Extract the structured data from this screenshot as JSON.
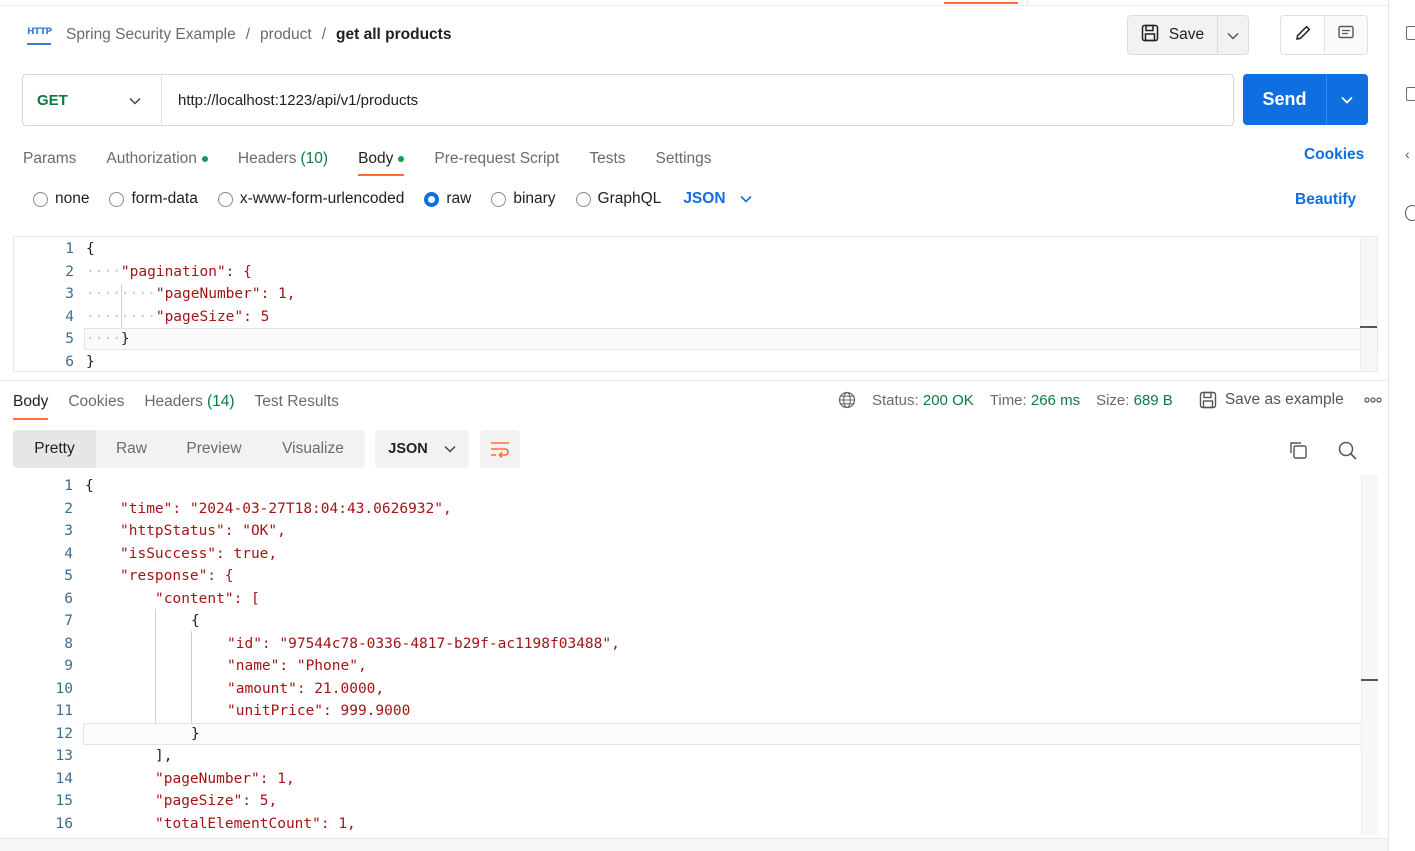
{
  "breadcrumb": {
    "items": [
      "Spring Security Example",
      "product"
    ],
    "separator": "/",
    "current": "get all products"
  },
  "header": {
    "http_icon_label": "HTTP",
    "save_label": "Save"
  },
  "request": {
    "method": "GET",
    "url": "http://localhost:1223/api/v1/products",
    "send_label": "Send",
    "tabs": [
      {
        "label": "Params"
      },
      {
        "label": "Authorization"
      },
      {
        "label": "Headers",
        "count": "(10)"
      },
      {
        "label": "Body"
      },
      {
        "label": "Pre-request Script"
      },
      {
        "label": "Tests"
      },
      {
        "label": "Settings"
      }
    ],
    "cookies_label": "Cookies",
    "body_types": [
      "none",
      "form-data",
      "x-www-form-urlencoded",
      "raw",
      "binary",
      "GraphQL"
    ],
    "selected_body_type": "raw",
    "format": "JSON",
    "beautify_label": "Beautify",
    "body_lines": [
      "{",
      "\"pagination\": {",
      "\"pageNumber\": 1,",
      "\"pageSize\": 5",
      "}",
      "}"
    ]
  },
  "response": {
    "tabs": [
      {
        "label": "Body"
      },
      {
        "label": "Cookies"
      },
      {
        "label": "Headers",
        "count": "(14)"
      },
      {
        "label": "Test Results"
      }
    ],
    "status_label": "Status:",
    "status_value": "200 OK",
    "time_label": "Time:",
    "time_value": "266 ms",
    "size_label": "Size:",
    "size_value": "689 B",
    "save_example_label": "Save as example",
    "view_modes": [
      "Pretty",
      "Raw",
      "Preview",
      "Visualize"
    ],
    "format": "JSON",
    "body_lines": [
      "{",
      "\"time\": \"2024-03-27T18:04:43.0626932\",",
      "\"httpStatus\": \"OK\",",
      "\"isSuccess\": true,",
      "\"response\": {",
      "\"content\": [",
      "{",
      "\"id\": \"97544c78-0336-4817-b29f-ac1198f03488\",",
      "\"name\": \"Phone\",",
      "\"amount\": 21.0000,",
      "\"unitPrice\": 999.9000",
      "}",
      "],",
      "\"pageNumber\": 1,",
      "\"pageSize\": 5,",
      "\"totalElementCount\": 1,"
    ]
  },
  "colors": {
    "accent": "#ff6c37",
    "primary": "#0f6ee0",
    "success": "#0b7a3f"
  }
}
